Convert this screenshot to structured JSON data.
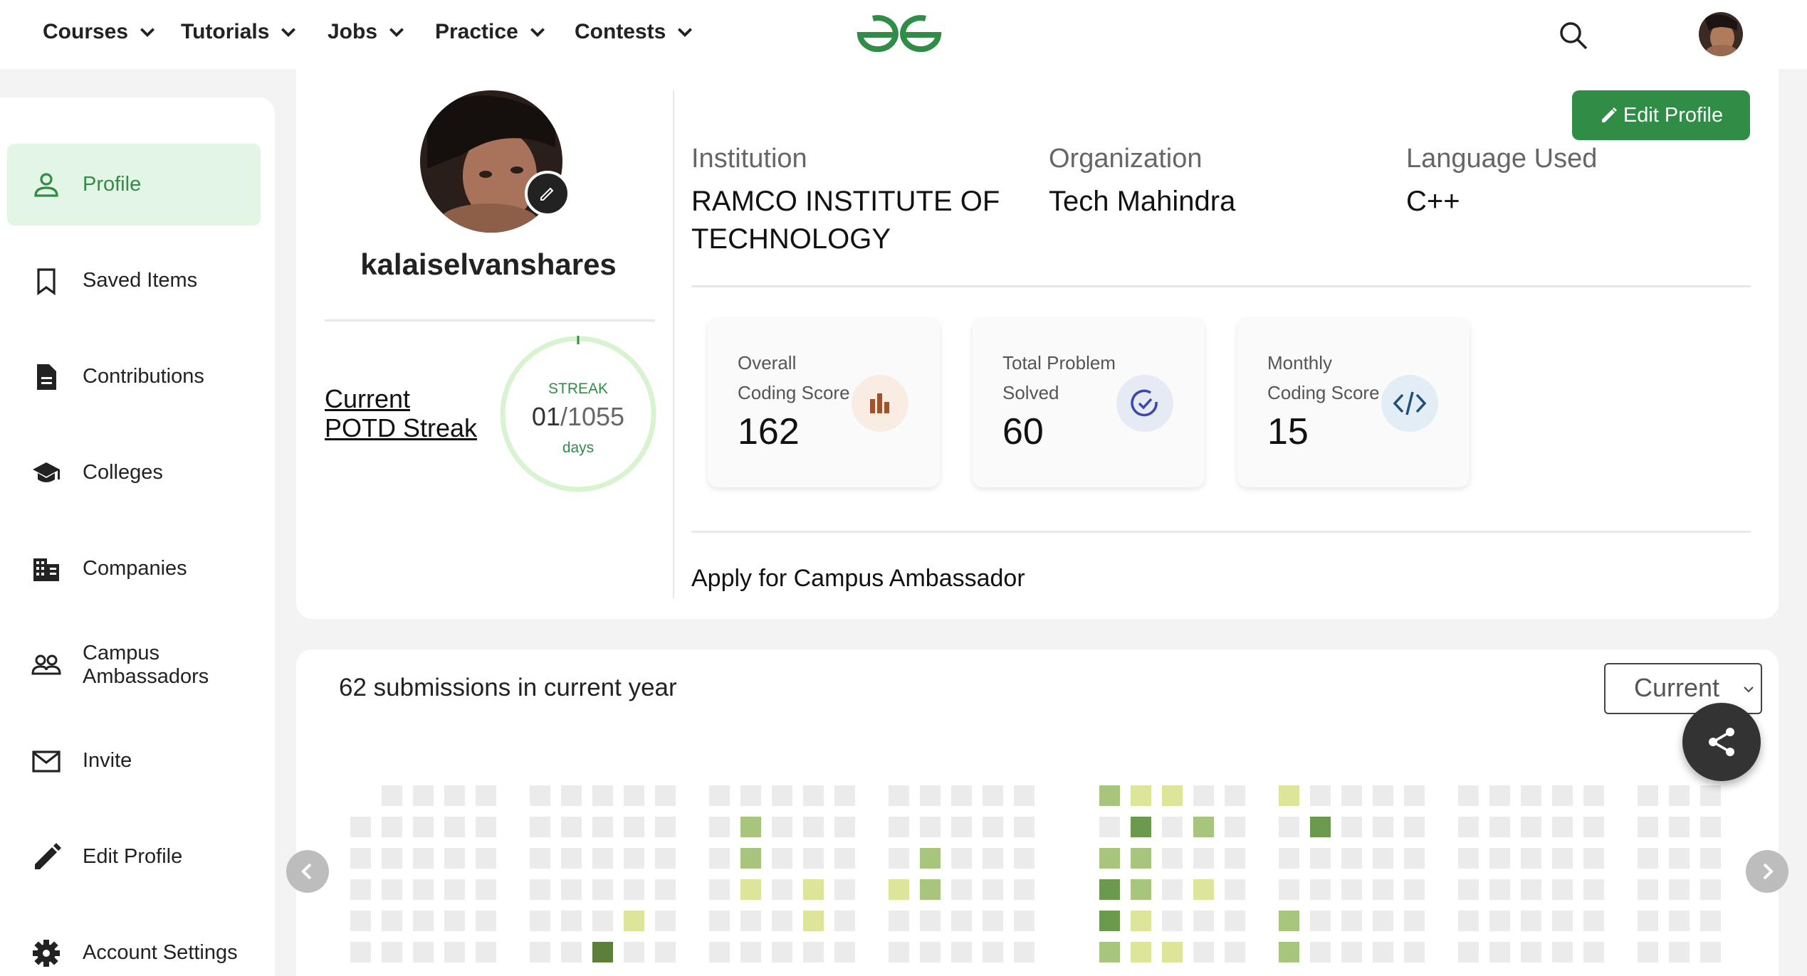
{
  "nav": {
    "items": [
      "Courses",
      "Tutorials",
      "Jobs",
      "Practice",
      "Contests"
    ],
    "logo_icon": "gfg-logo",
    "brand_color": "#2f8d46"
  },
  "sidebar": {
    "items": [
      {
        "label": "Profile",
        "icon": "user-icon",
        "active": true
      },
      {
        "label": "Saved Items",
        "icon": "bookmark-icon"
      },
      {
        "label": "Contributions",
        "icon": "document-icon"
      },
      {
        "label": "Colleges",
        "icon": "graduation-cap-icon"
      },
      {
        "label": "Companies",
        "icon": "building-icon"
      },
      {
        "label": "Campus Ambassadors",
        "icon": "people-icon"
      },
      {
        "label": "Invite",
        "icon": "mail-icon"
      },
      {
        "label": "Edit Profile",
        "icon": "pencil-icon"
      },
      {
        "label": "Account Settings",
        "icon": "gear-icon"
      }
    ]
  },
  "profile": {
    "username": "kalaiselvanshares",
    "edit_button": "Edit Profile",
    "potd_link": "Current POTD Streak",
    "streak": {
      "label": "STREAK",
      "current": "01",
      "separator": "/",
      "total": "1055",
      "unit": "days"
    },
    "info": [
      {
        "label": "Institution",
        "value": "RAMCO INSTITUTE OF TECHNOLOGY"
      },
      {
        "label": "Organization",
        "value": "Tech Mahindra"
      },
      {
        "label": "Language Used",
        "value": "C++"
      }
    ],
    "stats": [
      {
        "label_line1": "Overall",
        "label_line2": "Coding Score",
        "value": "162",
        "icon": "bar-chart-icon",
        "icon_bg": "#f8ece3",
        "icon_color": "#a0522d"
      },
      {
        "label_line1": "Total Problem",
        "label_line2": "Solved",
        "value": "60",
        "icon": "check-circle-icon",
        "icon_bg": "#e6eaf5",
        "icon_color": "#3949ab"
      },
      {
        "label_line1": "Monthly",
        "label_line2": "Coding Score",
        "value": "15",
        "icon": "code-icon",
        "icon_bg": "#e2edf5",
        "icon_color": "#1f4f7a"
      }
    ],
    "ambassador_link": "Apply for Campus Ambassador"
  },
  "activity": {
    "submissions_text": "62 submissions in current year",
    "year_select": "Current",
    "colors": {
      "empty": "#ebebeb",
      "l1": "#dde59b",
      "l2": "#a7c57d",
      "l3": "#6b9a4e",
      "l4": "#5c7f39"
    }
  }
}
